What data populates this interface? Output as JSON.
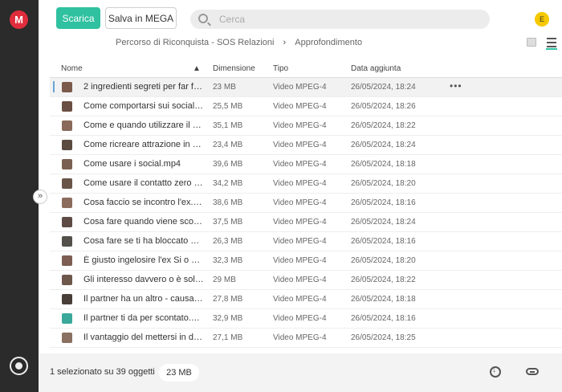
{
  "app": {
    "logo_letter": "M",
    "avatar_initial": "E"
  },
  "toolbar": {
    "download_label": "Scarica",
    "save_label": "Salva in MEGA"
  },
  "search": {
    "placeholder": "Cerca"
  },
  "breadcrumb": [
    "Percorso di Riconquista - SOS Relazioni",
    "Approfondimento"
  ],
  "columns": {
    "name": "Nome",
    "size": "Dimensione",
    "type": "Tipo",
    "date": "Data aggiunta"
  },
  "files": [
    {
      "name": "2 ingredienti segreti per far fu...",
      "size": "23 MB",
      "type": "Video MPEG-4",
      "date": "26/05/2024, 18:24"
    },
    {
      "name": "Come comportarsi sui social.m...",
      "size": "25,5 MB",
      "type": "Video MPEG-4",
      "date": "26/05/2024, 18:26"
    },
    {
      "name": "Come e quando utilizzare il co...",
      "size": "35,1 MB",
      "type": "Video MPEG-4",
      "date": "26/05/2024, 18:22"
    },
    {
      "name": "Come ricreare attrazione in un...",
      "size": "23,4 MB",
      "type": "Video MPEG-4",
      "date": "26/05/2024, 18:24"
    },
    {
      "name": "Come usare i social.mp4",
      "size": "39,6 MB",
      "type": "Video MPEG-4",
      "date": "26/05/2024, 18:18"
    },
    {
      "name": "Come usare il contatto zero ne...",
      "size": "34,2 MB",
      "type": "Video MPEG-4",
      "date": "26/05/2024, 18:20"
    },
    {
      "name": "Cosa faccio se incontro l'ex.mp4",
      "size": "38,6 MB",
      "type": "Video MPEG-4",
      "date": "26/05/2024, 18:16"
    },
    {
      "name": "Cosa fare quando viene scope...",
      "size": "37,5 MB",
      "type": "Video MPEG-4",
      "date": "26/05/2024, 18:24"
    },
    {
      "name": "Cosa fare se ti ha bloccato ov...",
      "size": "26,3 MB",
      "type": "Video MPEG-4",
      "date": "26/05/2024, 18:16"
    },
    {
      "name": "É giusto ingelosire l'ex Si o No....",
      "size": "32,3 MB",
      "type": "Video MPEG-4",
      "date": "26/05/2024, 18:20"
    },
    {
      "name": "Gli interesso davvero o è solo ...",
      "size": "29 MB",
      "type": "Video MPEG-4",
      "date": "26/05/2024, 18:22"
    },
    {
      "name": "Il partner ha un altro - causa o ...",
      "size": "27,8 MB",
      "type": "Video MPEG-4",
      "date": "26/05/2024, 18:18"
    },
    {
      "name": "Il partner ti da per scontato.mp4",
      "size": "32,9 MB",
      "type": "Video MPEG-4",
      "date": "26/05/2024, 18:16"
    },
    {
      "name": "Il vantaggio del mettersi in dis...",
      "size": "27,1 MB",
      "type": "Video MPEG-4",
      "date": "26/05/2024, 18:25"
    }
  ],
  "selected_index": 0,
  "more_label": "•••",
  "footer": {
    "selection_text": "1 selezionato su 39 oggetti",
    "selection_size": "23 MB"
  },
  "colors": {
    "accent": "#2fc1a0",
    "brand": "#e02d3c"
  }
}
